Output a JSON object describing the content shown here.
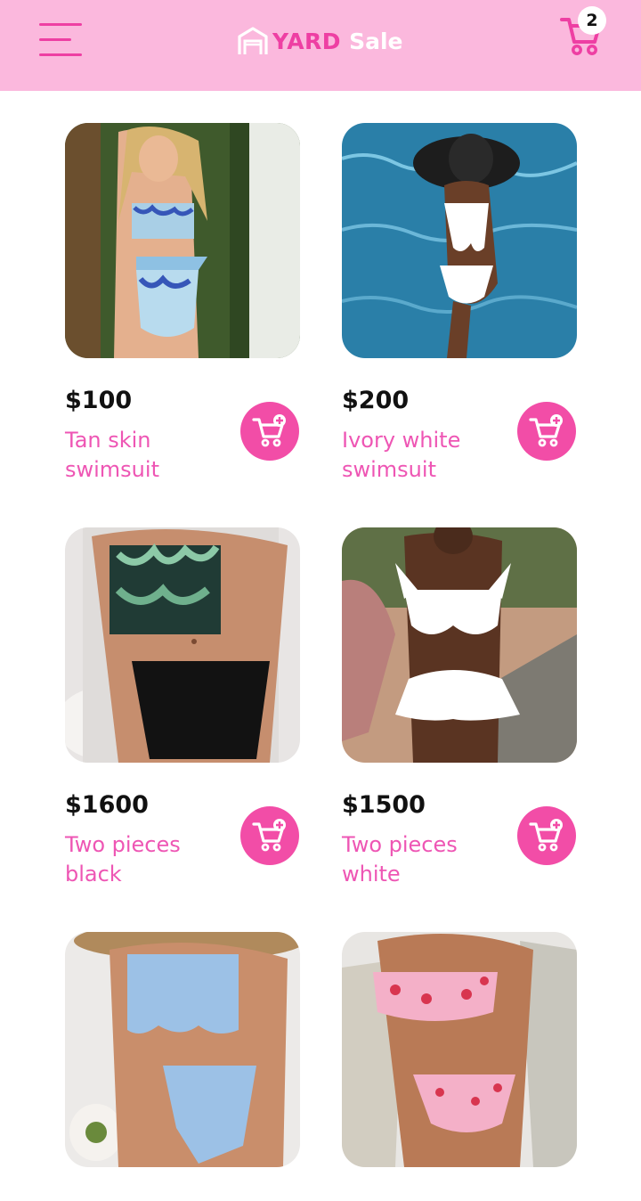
{
  "header": {
    "brand_yard": "YARD",
    "brand_sale": "Sale",
    "cart_count": "2",
    "icons": {
      "menu": "hamburger-menu-icon",
      "logo": "house-logo-icon",
      "cart": "shopping-cart-icon"
    }
  },
  "colors": {
    "header_bg": "#fbb8dd",
    "accent": "#ee3fa3",
    "add_button": "#f24da7",
    "product_name": "#ee56b4"
  },
  "products": [
    {
      "price": "$100",
      "name": "Tan skin swimsuit",
      "image": "woman in blue floral wrap bikini"
    },
    {
      "price": "$200",
      "name": "Ivory white swimsuit",
      "image": "woman in white cutout swimsuit and black hat in pool"
    },
    {
      "price": "$1600",
      "name": "Two pieces black",
      "image": "woman in palm print top and black high-waist bottoms"
    },
    {
      "price": "$1500",
      "name": "Two pieces white",
      "image": "woman in white ruffle bikini with skirt"
    },
    {
      "price": "",
      "name": "",
      "image": "woman in light blue textured bikini"
    },
    {
      "price": "",
      "name": "",
      "image": "woman in pink strawberry print bikini"
    }
  ]
}
